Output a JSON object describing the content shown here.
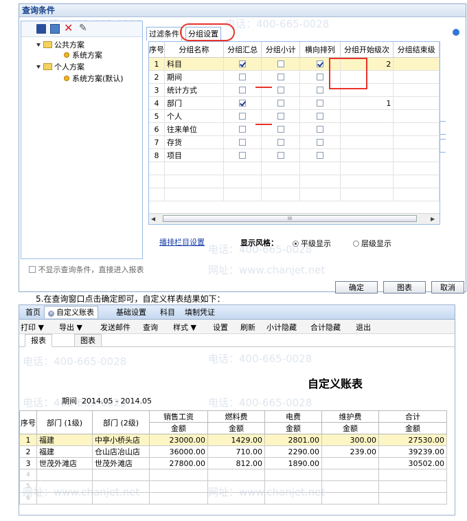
{
  "dialog": {
    "title": "查询条件",
    "tree": {
      "public_label": "公共方案",
      "public_child": "系统方案",
      "personal_label": "个人方案",
      "personal_child": "系统方案(默认)"
    },
    "tabs": [
      "过滤条件",
      "分组设置"
    ],
    "grid": {
      "headers": [
        "序号",
        "分组名称",
        "分组汇总",
        "分组小计",
        "横向排列",
        "分组开始级次",
        "分组结束级"
      ],
      "rows": [
        {
          "no": "1",
          "name": "科目",
          "sum": true,
          "sub": false,
          "horiz": true,
          "start": "2"
        },
        {
          "no": "2",
          "name": "期间",
          "sum": false,
          "sub": false,
          "horiz": false,
          "start": ""
        },
        {
          "no": "3",
          "name": "统计方式",
          "sum": false,
          "sub": false,
          "horiz": false,
          "start": ""
        },
        {
          "no": "4",
          "name": "部门",
          "sum": true,
          "sub": false,
          "horiz": false,
          "start": "1"
        },
        {
          "no": "5",
          "name": "个人",
          "sum": false,
          "sub": false,
          "horiz": false,
          "start": ""
        },
        {
          "no": "6",
          "name": "往来单位",
          "sum": false,
          "sub": false,
          "horiz": false,
          "start": ""
        },
        {
          "no": "7",
          "name": "存货",
          "sum": false,
          "sub": false,
          "horiz": false,
          "start": ""
        },
        {
          "no": "8",
          "name": "项目",
          "sum": false,
          "sub": false,
          "horiz": false,
          "start": ""
        }
      ],
      "scroll_mark": "III"
    },
    "header_link": "播排栏目设置",
    "display_style_label": "显示风格：",
    "radio_flat": "平级显示",
    "radio_tier": "层级显示",
    "no_show_checkbox": "不显示查询条件，直接进入报表",
    "btn_ok": "确定",
    "btn_chart": "图表",
    "btn_cancel": "取消",
    "watermark_phone": "电话：400-665-0028",
    "watermark_site": "网址：www.chanjet.net"
  },
  "instruction": "5.在查询窗口点击确定即可，自定义样表结果如下：",
  "report_window": {
    "top_tabs": [
      "首页",
      "自定义账表",
      "基础设置",
      "科目",
      "填制凭证"
    ],
    "menu": [
      "打印 ▼",
      "导出 ▼",
      "发送邮件",
      "查询",
      "样式 ▼",
      "设置",
      "刷新",
      "小计隐藏",
      "合计隐藏",
      "退出"
    ],
    "sub_tabs": [
      "报表",
      "图表"
    ],
    "report_title": "自定义账表",
    "period_label": "期间",
    "period_value": "2014.05 - 2014.05",
    "col_headers": {
      "no": "序号",
      "dept1": "部门 (1级)",
      "dept2": "部门 (2级)",
      "c1": "销售工资",
      "c2": "燃料费",
      "c3": "电费",
      "c4": "维护费",
      "c5": "合计",
      "sub": "金额"
    },
    "rows": [
      {
        "no": "1",
        "d1": "福建",
        "d2": "中亭小桥头店",
        "c1": "23000.00",
        "c2": "1429.00",
        "c3": "2801.00",
        "c4": "300.00",
        "c5": "27530.00"
      },
      {
        "no": "2",
        "d1": "福建",
        "d2": "仓山店冶山店",
        "c1": "36000.00",
        "c2": "710.00",
        "c3": "2290.00",
        "c4": "239.00",
        "c5": "39239.00"
      },
      {
        "no": "3",
        "d1": "世茂外滩店",
        "d2": "世茂外滩店",
        "c1": "27800.00",
        "c2": "812.00",
        "c3": "1890.00",
        "c4": "",
        "c5": "30502.00"
      }
    ],
    "empty_rows": [
      "4",
      "5",
      "6"
    ]
  },
  "colors": {
    "highlight": "#fdf5c4",
    "annotation_red": "#e8332a",
    "link_blue": "#1a3fa8"
  }
}
